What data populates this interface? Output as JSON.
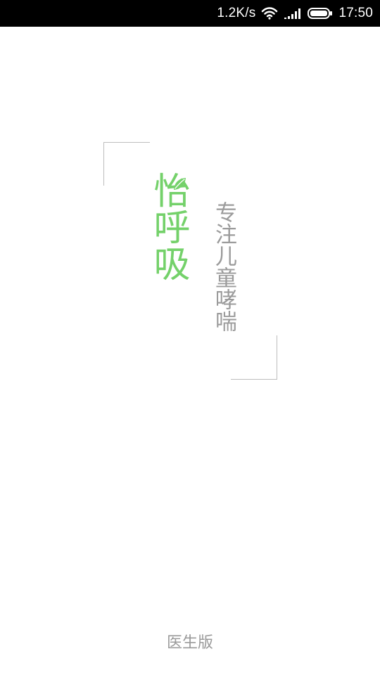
{
  "status_bar": {
    "network_speed": "1.2K/s",
    "time": "17:50",
    "icons": [
      "wifi-icon",
      "signal-icon",
      "battery-icon"
    ]
  },
  "splash": {
    "app_name": "怡呼吸",
    "tagline": "专注儿童哮喘",
    "edition": "医生版"
  },
  "colors": {
    "brand_green": "#74d16a",
    "tagline_gray": "#9b9b9b",
    "frame_gray": "#bdbdbd",
    "status_bar": "#000000"
  }
}
